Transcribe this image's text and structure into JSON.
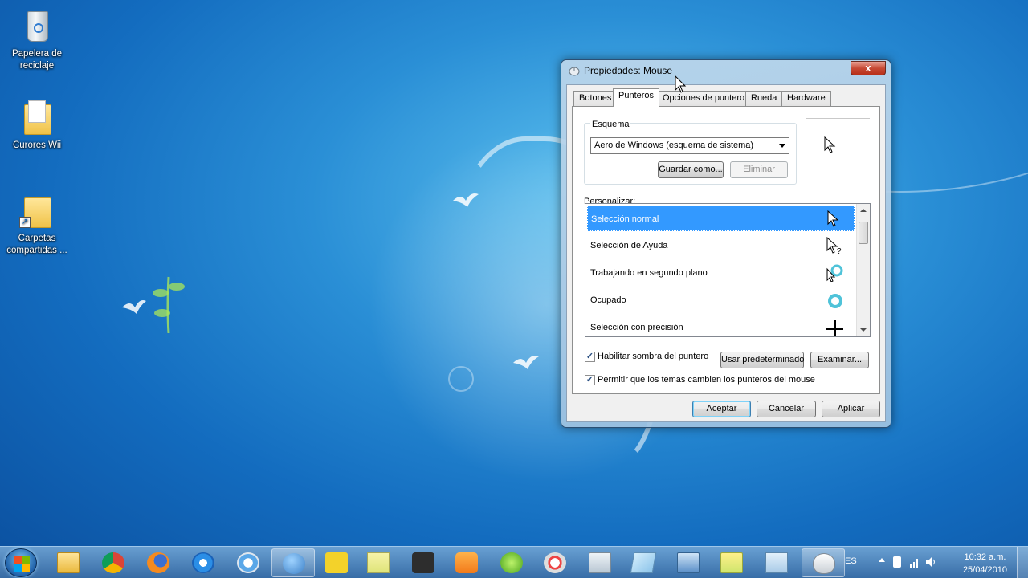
{
  "desktop": {
    "icons": [
      {
        "label": "Papelera de reciclaje"
      },
      {
        "label": "Curores Wii"
      },
      {
        "label": "Carpetas compartidas ..."
      }
    ]
  },
  "dialog": {
    "title": "Propiedades: Mouse",
    "close_label": "x",
    "tabs": [
      {
        "label": "Botones"
      },
      {
        "label": "Punteros"
      },
      {
        "label": "Opciones de puntero"
      },
      {
        "label": "Rueda"
      },
      {
        "label": "Hardware"
      }
    ],
    "active_tab": "Punteros",
    "scheme_group_label": "Esquema",
    "scheme_value": "Aero de Windows (esquema de sistema)",
    "save_as_label": "Guardar como...",
    "delete_label": "Eliminar",
    "customize_label": "Personalizar:",
    "pointers": [
      {
        "label": "Selección normal",
        "icon": "arrow-cursor-icon",
        "selected": true
      },
      {
        "label": "Selección de Ayuda",
        "icon": "help-cursor-icon",
        "selected": false
      },
      {
        "label": "Trabajando en segundo plano",
        "icon": "working-background-cursor-icon",
        "selected": false
      },
      {
        "label": "Ocupado",
        "icon": "busy-cursor-icon",
        "selected": false
      },
      {
        "label": "Selección con precisión",
        "icon": "crosshair-cursor-icon",
        "selected": false
      }
    ],
    "shadow_checkbox": {
      "label": "Habilitar sombra del puntero",
      "checked": true
    },
    "themes_checkbox": {
      "label": "Permitir que los temas cambien los punteros del mouse",
      "checked": true
    },
    "use_default_label": "Usar predeterminado",
    "browse_label": "Examinar...",
    "ok_label": "Aceptar",
    "cancel_label": "Cancelar",
    "apply_label": "Aplicar"
  },
  "taskbar": {
    "items": [
      {
        "icon": "windows-explorer-icon"
      },
      {
        "icon": "chrome-icon"
      },
      {
        "icon": "firefox-icon"
      },
      {
        "icon": "internet-explorer-icon"
      },
      {
        "icon": "safari-icon"
      },
      {
        "icon": "users-control-panel-icon"
      },
      {
        "icon": "bird-app-icon"
      },
      {
        "icon": "notes-icon"
      },
      {
        "icon": "camcorder-icon"
      },
      {
        "icon": "media-player-icon"
      },
      {
        "icon": "xbox-icon"
      },
      {
        "icon": "paint-icon"
      },
      {
        "icon": "calculator-icon"
      },
      {
        "icon": "notepad-icon"
      },
      {
        "icon": "network-icon"
      },
      {
        "icon": "folder-sync-icon"
      },
      {
        "icon": "window-icon"
      },
      {
        "icon": "mouse-icon"
      }
    ],
    "language": "ES",
    "time": "10:32 a.m.",
    "date": "25/04/2010"
  },
  "colors": {
    "selection": "#3399ff",
    "desktop": "#2a8fd6"
  }
}
